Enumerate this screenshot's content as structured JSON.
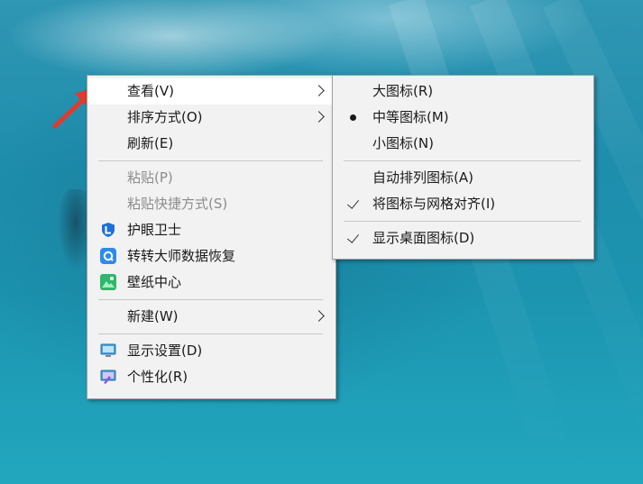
{
  "main_menu": {
    "view": "查看(V)",
    "sort": "排序方式(O)",
    "refresh": "刷新(E)",
    "paste": "粘贴(P)",
    "paste_shortcut": "粘贴快捷方式(S)",
    "eye_guard": "护眼卫士",
    "data_recovery": "转转大师数据恢复",
    "wallpaper": "壁纸中心",
    "new": "新建(W)",
    "display_settings": "显示设置(D)",
    "personalize": "个性化(R)"
  },
  "view_submenu": {
    "large_icons": "大图标(R)",
    "medium_icons": "中等图标(M)",
    "small_icons": "小图标(N)",
    "auto_arrange": "自动排列图标(A)",
    "align_grid": "将图标与网格对齐(I)",
    "show_desktop_icons": "显示桌面图标(D)"
  },
  "colors": {
    "pointer_arrow": "#e23a2c",
    "menu_bg": "#f2f2f2",
    "eye_guard_icon": "#1f6fd6",
    "recovery_icon": "#2e8be8",
    "wallpaper_icon": "#2db86b"
  },
  "icons": {
    "eye_guard": "eye-guard-app-icon",
    "data_recovery": "data-recovery-app-icon",
    "wallpaper": "wallpaper-app-icon",
    "display_settings": "monitor-icon",
    "personalize": "personalize-monitor-icon",
    "pointer": "red-arrow-icon"
  }
}
